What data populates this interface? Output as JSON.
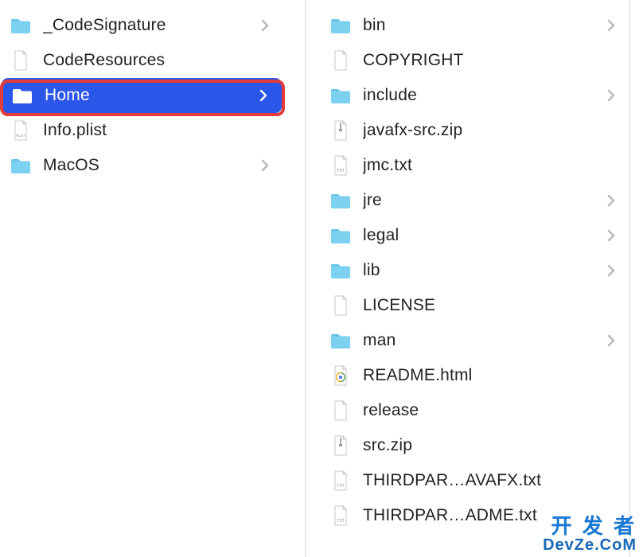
{
  "columns": {
    "left": {
      "items": [
        {
          "name": "_CodeSignature",
          "icon": "folder",
          "hasChildren": true,
          "selected": false
        },
        {
          "name": "CodeResources",
          "icon": "file",
          "hasChildren": false,
          "selected": false
        },
        {
          "name": "Home",
          "icon": "folder",
          "hasChildren": true,
          "selected": true,
          "highlighted": true
        },
        {
          "name": "Info.plist",
          "icon": "plist",
          "hasChildren": false,
          "selected": false
        },
        {
          "name": "MacOS",
          "icon": "folder",
          "hasChildren": true,
          "selected": false
        }
      ]
    },
    "middle": {
      "items": [
        {
          "name": "bin",
          "icon": "folder",
          "hasChildren": true
        },
        {
          "name": "COPYRIGHT",
          "icon": "file",
          "hasChildren": false
        },
        {
          "name": "include",
          "icon": "folder",
          "hasChildren": true
        },
        {
          "name": "javafx-src.zip",
          "icon": "zip",
          "hasChildren": false
        },
        {
          "name": "jmc.txt",
          "icon": "txt",
          "hasChildren": false
        },
        {
          "name": "jre",
          "icon": "folder",
          "hasChildren": true
        },
        {
          "name": "legal",
          "icon": "folder",
          "hasChildren": true
        },
        {
          "name": "lib",
          "icon": "folder",
          "hasChildren": true
        },
        {
          "name": "LICENSE",
          "icon": "file",
          "hasChildren": false
        },
        {
          "name": "man",
          "icon": "folder",
          "hasChildren": true
        },
        {
          "name": "README.html",
          "icon": "html",
          "hasChildren": false
        },
        {
          "name": "release",
          "icon": "file",
          "hasChildren": false
        },
        {
          "name": "src.zip",
          "icon": "zip",
          "hasChildren": false
        },
        {
          "name": "THIRDPAR…AVAFX.txt",
          "icon": "txt",
          "hasChildren": false
        },
        {
          "name": "THIRDPAR…ADME.txt",
          "icon": "txt",
          "hasChildren": false
        }
      ]
    }
  },
  "watermark": {
    "line1": "开 发 者",
    "line2": "DevZe.CoM"
  },
  "colors": {
    "folder": "#7cd0f0",
    "selection": "#2a56ea",
    "highlightBorder": "#e23b3b",
    "chevron": "#b8b8b8",
    "chevronSelected": "#ffffff"
  }
}
